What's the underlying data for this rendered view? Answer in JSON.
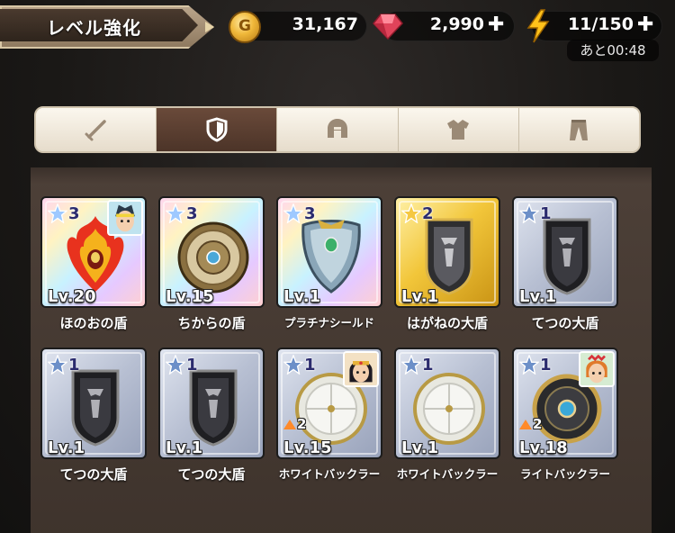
{
  "header": {
    "title": "レベル強化",
    "gold": "31,167",
    "gems": "2,990",
    "stamina": "11/150",
    "timer": "あと00:48",
    "plus": "✚"
  },
  "tabs": [
    {
      "icon": "sword-icon",
      "active": false
    },
    {
      "icon": "shield-icon",
      "active": true
    },
    {
      "icon": "helmet-icon",
      "active": false
    },
    {
      "icon": "armor-icon",
      "active": false
    },
    {
      "icon": "pants-icon",
      "active": false
    }
  ],
  "items": [
    {
      "name": "ほのおの盾",
      "rarity": "3",
      "level": "Lv.20",
      "tier": "r3",
      "art": "flame-shield",
      "avatar": true,
      "upgrade": ""
    },
    {
      "name": "ちからの盾",
      "rarity": "3",
      "level": "Lv.15",
      "tier": "r3",
      "art": "round-shield",
      "avatar": false,
      "upgrade": ""
    },
    {
      "name": "プラチナシールド",
      "rarity": "3",
      "level": "Lv.1",
      "tier": "r3",
      "art": "platinum-shield",
      "avatar": false,
      "upgrade": ""
    },
    {
      "name": "はがねの大盾",
      "rarity": "2",
      "level": "Lv.1",
      "tier": "r2",
      "art": "iron-shield",
      "avatar": false,
      "upgrade": ""
    },
    {
      "name": "てつの大盾",
      "rarity": "1",
      "level": "Lv.1",
      "tier": "r1",
      "art": "iron-shield",
      "avatar": false,
      "upgrade": ""
    },
    {
      "name": "てつの大盾",
      "rarity": "1",
      "level": "Lv.1",
      "tier": "r1",
      "art": "iron-shield",
      "avatar": false,
      "upgrade": ""
    },
    {
      "name": "てつの大盾",
      "rarity": "1",
      "level": "Lv.1",
      "tier": "r1",
      "art": "iron-shield",
      "avatar": false,
      "upgrade": ""
    },
    {
      "name": "ホワイトバックラー",
      "rarity": "1",
      "level": "Lv.15",
      "tier": "r1",
      "art": "white-buckler",
      "avatar": true,
      "upgrade": "2"
    },
    {
      "name": "ホワイトバックラー",
      "rarity": "1",
      "level": "Lv.1",
      "tier": "r1",
      "art": "white-buckler",
      "avatar": false,
      "upgrade": ""
    },
    {
      "name": "ライトバックラー",
      "rarity": "1",
      "level": "Lv.18",
      "tier": "r1",
      "art": "light-buckler",
      "avatar": true,
      "upgrade": "2"
    }
  ],
  "colors": {
    "gold": "#f0b83a",
    "gem": "#e0435a",
    "bolt": "#ffc21a",
    "active_tab": "#4c3428"
  }
}
